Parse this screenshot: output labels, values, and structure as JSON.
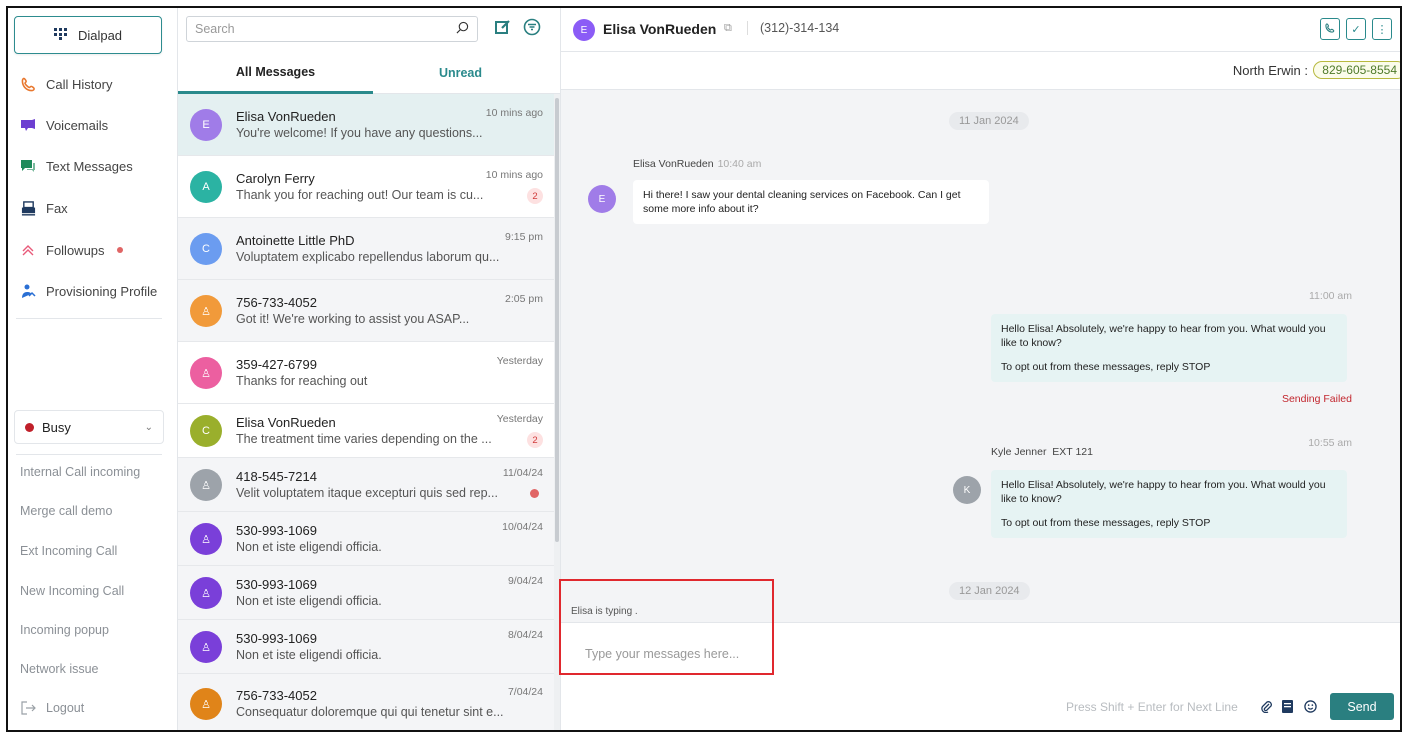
{
  "nav": {
    "dialpad_label": "Dialpad",
    "items": [
      {
        "label": "Call History",
        "icon": "phone-icon"
      },
      {
        "label": "Voicemails",
        "icon": "voicemail-icon"
      },
      {
        "label": "Text Messages",
        "icon": "chat-icon"
      },
      {
        "label": "Fax",
        "icon": "fax-icon"
      },
      {
        "label": "Followups",
        "icon": "followup-icon"
      },
      {
        "label": "Provisioning Profile",
        "icon": "user-share-icon"
      }
    ],
    "status": "Busy",
    "demo_items": [
      "Internal Call incoming",
      "Merge call demo",
      "Ext Incoming Call",
      "New Incoming Call",
      "Incoming popup",
      "Network issue"
    ],
    "logout_label": "Logout"
  },
  "list": {
    "search_placeholder": "Search",
    "tabs": {
      "all": "All Messages",
      "unread": "Unread"
    },
    "conversations": [
      {
        "initial": "E",
        "name": "Elisa VonRueden",
        "preview": "You're welcome! If you have any questions...",
        "time": "10 mins ago",
        "color": "#a07ce8",
        "badge": ""
      },
      {
        "initial": "A",
        "name": "Carolyn Ferry",
        "preview": "Thank you for reaching out! Our team is cu...",
        "time": "10 mins ago",
        "color": "#2bb3a3",
        "badge": "2"
      },
      {
        "initial": "C",
        "name": "Antoinette Little PhD",
        "preview": "Voluptatem explicabo repellendus laborum qu...",
        "time": "9:15 pm",
        "color": "#6b9cf0",
        "badge": ""
      },
      {
        "initial": "♙",
        "name": "756-733-4052",
        "preview": "Got it! We're working to assist you ASAP...",
        "time": "2:05 pm",
        "color": "#f19a3a",
        "badge": ""
      },
      {
        "initial": "♙",
        "name": "359-427-6799",
        "preview": "Thanks for reaching out",
        "time": "Yesterday",
        "color": "#ec5fa0",
        "badge": ""
      },
      {
        "initial": "C",
        "name": "Elisa VonRueden",
        "preview": "The treatment time varies depending on the ...",
        "time": "Yesterday",
        "color": "#9aaf2c",
        "badge": "2"
      },
      {
        "initial": "♙",
        "name": "418-545-7214",
        "preview": "Velit voluptatem itaque excepturi quis sed rep...",
        "time": "11/04/24",
        "color": "#9da3aa",
        "badge": ""
      },
      {
        "initial": "♙",
        "name": "530-993-1069",
        "preview": "Non et iste eligendi officia.",
        "time": "10/04/24",
        "color": "#7a3fd9",
        "badge": ""
      },
      {
        "initial": "♙",
        "name": "530-993-1069",
        "preview": "Non et iste eligendi officia.",
        "time": "9/04/24",
        "color": "#7a3fd9",
        "badge": ""
      },
      {
        "initial": "♙",
        "name": "530-993-1069",
        "preview": "Non et iste eligendi officia.",
        "time": "8/04/24",
        "color": "#7a3fd9",
        "badge": ""
      },
      {
        "initial": "♙",
        "name": "756-733-4052",
        "preview": "Consequatur doloremque qui qui tenetur sint e...",
        "time": "7/04/24",
        "color": "#e08419",
        "badge": ""
      }
    ]
  },
  "chat": {
    "contact_initial": "E",
    "contact_name": "Elisa VonRueden",
    "contact_phone": "(312)-314-134",
    "sub_label": "North Erwin :",
    "sub_number": "829-605-8554",
    "date1": "11 Jan 2024",
    "msg1": {
      "sender": "Elisa VonRueden",
      "time": "10:40 am",
      "initial": "E",
      "text": "Hi there! I saw your dental cleaning services on Facebook. Can I get some more info about it?"
    },
    "msg2": {
      "time": "11:00 am",
      "line1": "Hello Elisa! Absolutely, we're happy to hear from you. What would you like to know?",
      "line2": "To opt out from these messages, reply STOP",
      "status": "Sending Failed"
    },
    "msg3": {
      "sender": "Kyle Jenner",
      "ext": "EXT 121",
      "time": "10:55 am",
      "initial": "K",
      "line1": "Hello Elisa! Absolutely, we're happy to hear from you. What would you like to know?",
      "line2": "To opt out from these messages, reply STOP"
    },
    "date2": "12 Jan 2024",
    "typing": "Elisa is typing .",
    "composer_placeholder": "Type your messages here...",
    "hint": "Press Shift + Enter for Next Line",
    "send_label": "Send"
  },
  "colors": {
    "accent": "#2a7f80",
    "busy": "#c0202a",
    "failed": "#c2262e"
  }
}
